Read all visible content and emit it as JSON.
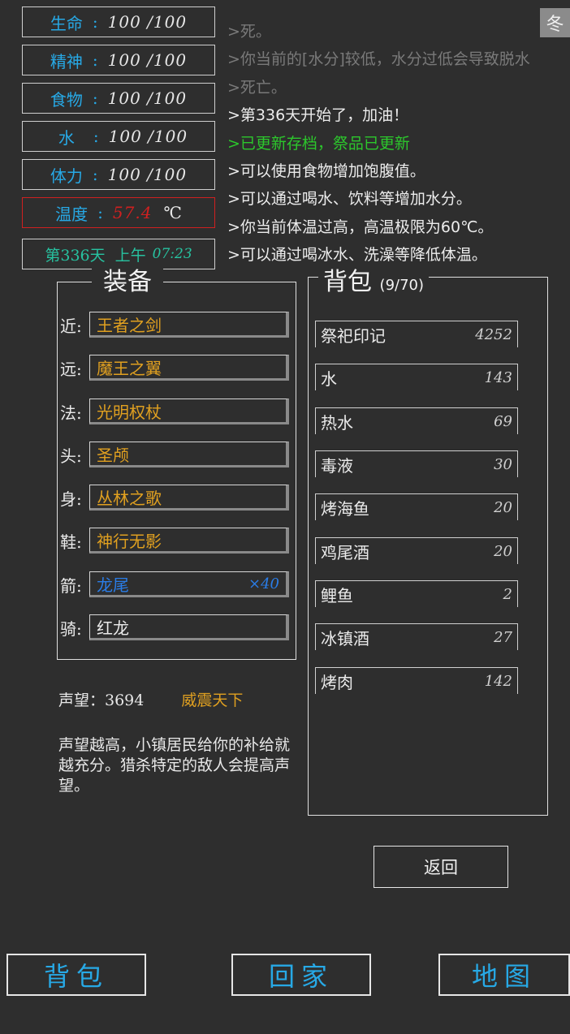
{
  "status": {
    "life": {
      "label": "生命",
      "value": "100 /100"
    },
    "spirit": {
      "label": "精神",
      "value": "100 /100"
    },
    "food": {
      "label": "食物",
      "value": "100 /100"
    },
    "water": {
      "label": "水",
      "value": "100 /100"
    },
    "stamina": {
      "label": "体力",
      "value": "100 /100"
    },
    "temperature": {
      "label": "温度",
      "value": "57.4",
      "unit": "℃"
    },
    "day": {
      "label": "第336天",
      "period": "上午",
      "time": "07:23"
    },
    "colon": ":"
  },
  "season": "冬",
  "log": [
    ">死。",
    ">你当前的[水分]较低，水分过低会导致脱水",
    ">死亡。",
    ">第336天开始了，加油！",
    ">已更新存档，祭品已更新",
    ">可以使用食物增加饱腹值。",
    ">可以通过喝水、饮料等增加水分。",
    ">你当前体温过高，高温极限为60℃。",
    ">可以通过喝冰水、洗澡等降低体温。"
  ],
  "equipment": {
    "title": "装备",
    "slots": [
      {
        "label": "近:",
        "item": "王者之剑",
        "count": ""
      },
      {
        "label": "远:",
        "item": "魔王之翼",
        "count": ""
      },
      {
        "label": "法:",
        "item": "光明权杖",
        "count": ""
      },
      {
        "label": "头:",
        "item": "圣颅",
        "count": ""
      },
      {
        "label": "身:",
        "item": "丛林之歌",
        "count": ""
      },
      {
        "label": "鞋:",
        "item": "神行无影",
        "count": ""
      },
      {
        "label": "箭:",
        "item": "龙尾",
        "count": "×40"
      },
      {
        "label": "骑:",
        "item": "红龙",
        "count": ""
      }
    ]
  },
  "reputation": {
    "label": "声望：3694",
    "title": "威震天下",
    "description": "声望越高，小镇居民给你的补给就越充分。猎杀特定的敌人会提高声望。"
  },
  "backpack": {
    "title": "背包",
    "capacity": "(9/70)",
    "items": [
      {
        "name": "祭祀印记",
        "count": "4252"
      },
      {
        "name": "水",
        "count": "143"
      },
      {
        "name": "热水",
        "count": "69"
      },
      {
        "name": "毒液",
        "count": "30"
      },
      {
        "name": "烤海鱼",
        "count": "20"
      },
      {
        "name": "鸡尾酒",
        "count": "20"
      },
      {
        "name": "鲤鱼",
        "count": "2"
      },
      {
        "name": "冰镇酒",
        "count": "27"
      },
      {
        "name": "烤肉",
        "count": "142"
      }
    ]
  },
  "buttons": {
    "return": "返回",
    "nav_backpack": "背包",
    "nav_home": "回家",
    "nav_map": "地图"
  },
  "colors": {
    "background": "#2e2e2e",
    "stat_blue": "#27a9e6",
    "warning_red": "#d02020",
    "gold": "#e0a020",
    "green": "#2cc72c"
  }
}
